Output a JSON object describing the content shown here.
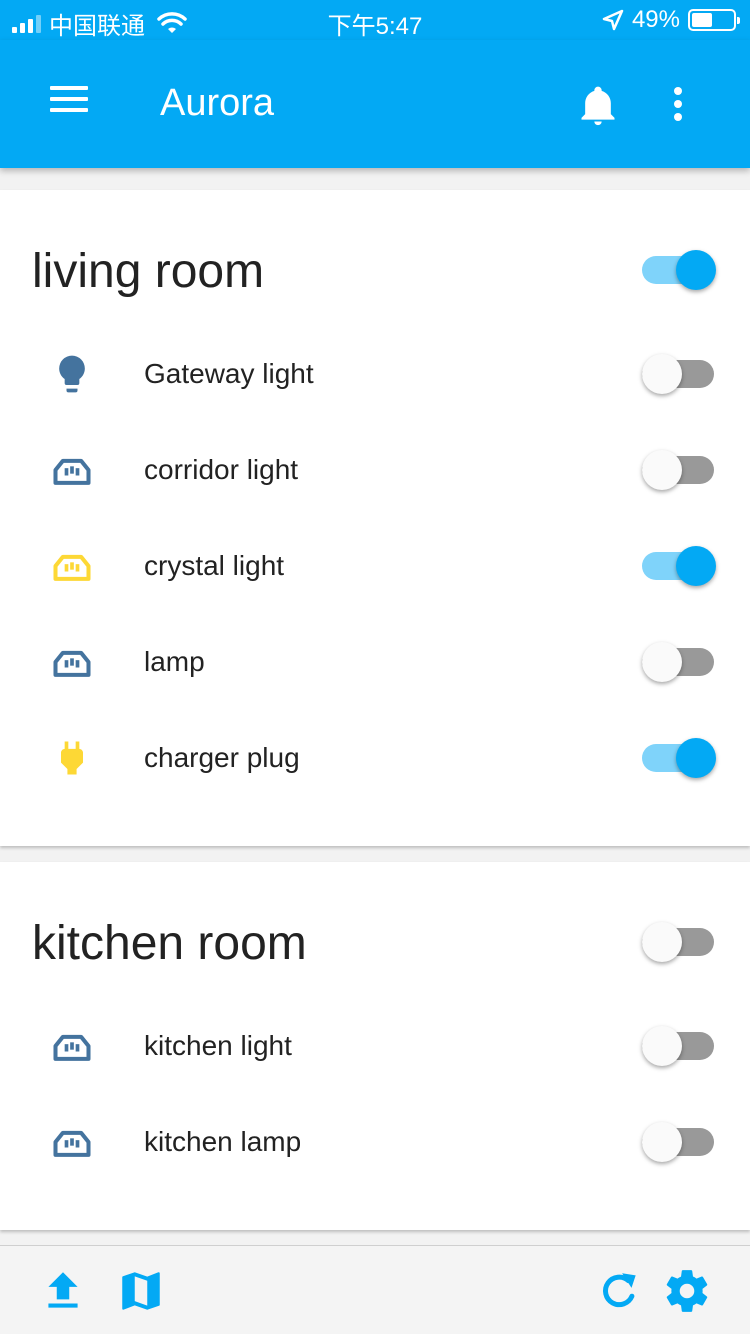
{
  "status_bar": {
    "carrier": "中国联通",
    "time": "下午5:47",
    "battery": "49%"
  },
  "app_bar": {
    "title": "Aurora"
  },
  "rooms": [
    {
      "name": "living room",
      "on": true,
      "devices": [
        {
          "label": "Gateway light",
          "icon": "lightbulb-icon",
          "icon_color": "#44739e",
          "on": false
        },
        {
          "label": "corridor light",
          "icon": "power-socket-icon",
          "icon_color": "#44739e",
          "on": false
        },
        {
          "label": "crystal light",
          "icon": "power-socket-icon",
          "icon_color": "#fdd835",
          "on": true
        },
        {
          "label": "lamp",
          "icon": "power-socket-icon",
          "icon_color": "#44739e",
          "on": false
        },
        {
          "label": "charger plug",
          "icon": "power-plug-icon",
          "icon_color": "#fdd835",
          "on": true
        }
      ]
    },
    {
      "name": "kitchen room",
      "on": false,
      "devices": [
        {
          "label": "kitchen light",
          "icon": "power-socket-icon",
          "icon_color": "#44739e",
          "on": false
        },
        {
          "label": "kitchen lamp",
          "icon": "power-socket-icon",
          "icon_color": "#44739e",
          "on": false
        }
      ]
    }
  ],
  "colors": {
    "primary": "#03a9f4",
    "toggle_on_track": "#7fd3fa",
    "toggle_off_track": "#999999",
    "icon_off": "#44739e",
    "icon_on": "#fdd835"
  },
  "bottom_bar": {
    "left_icons": [
      "upload-icon",
      "map-icon"
    ],
    "right_icons": [
      "refresh-icon",
      "settings-icon"
    ]
  }
}
